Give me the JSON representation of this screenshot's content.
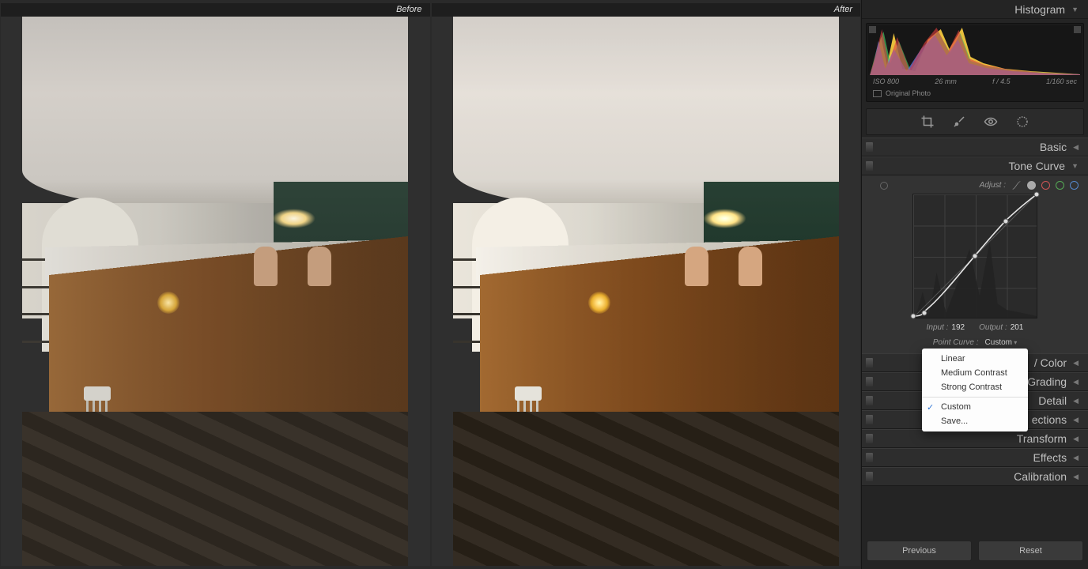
{
  "preview": {
    "before_label": "Before",
    "after_label": "After"
  },
  "sidebar": {
    "histogram_title": "Histogram",
    "exif": {
      "iso": "ISO 800",
      "focal": "26 mm",
      "aperture": "f / 4.5",
      "shutter": "1/160 sec"
    },
    "original_photo_label": "Original Photo",
    "panels": {
      "basic": "Basic",
      "tone_curve": "Tone Curve",
      "color": " / Color",
      "grading": "Grading",
      "detail": "Detail",
      "corrections": "ections",
      "transform": "Transform",
      "effects": "Effects",
      "calibration": "Calibration"
    },
    "tone_curve": {
      "adjust_label": "Adjust :",
      "input_label": "Input :",
      "input_value": "192",
      "output_label": "Output :",
      "output_value": "201",
      "point_curve_label": "Point Curve :",
      "point_curve_value": "Custom",
      "dropdown": {
        "linear": "Linear",
        "medium": "Medium Contrast",
        "strong": "Strong Contrast",
        "custom": "Custom",
        "save": "Save..."
      }
    },
    "footer": {
      "previous": "Previous",
      "reset": "Reset"
    }
  },
  "chart_data": {
    "type": "line",
    "title": "Tone Curve",
    "xlabel": "Input",
    "ylabel": "Output",
    "xlim": [
      0,
      255
    ],
    "ylim": [
      0,
      255
    ],
    "series": [
      {
        "name": "RGB",
        "values": [
          [
            0,
            2
          ],
          [
            22,
            10
          ],
          [
            128,
            128
          ],
          [
            192,
            201
          ],
          [
            255,
            255
          ]
        ]
      }
    ]
  }
}
